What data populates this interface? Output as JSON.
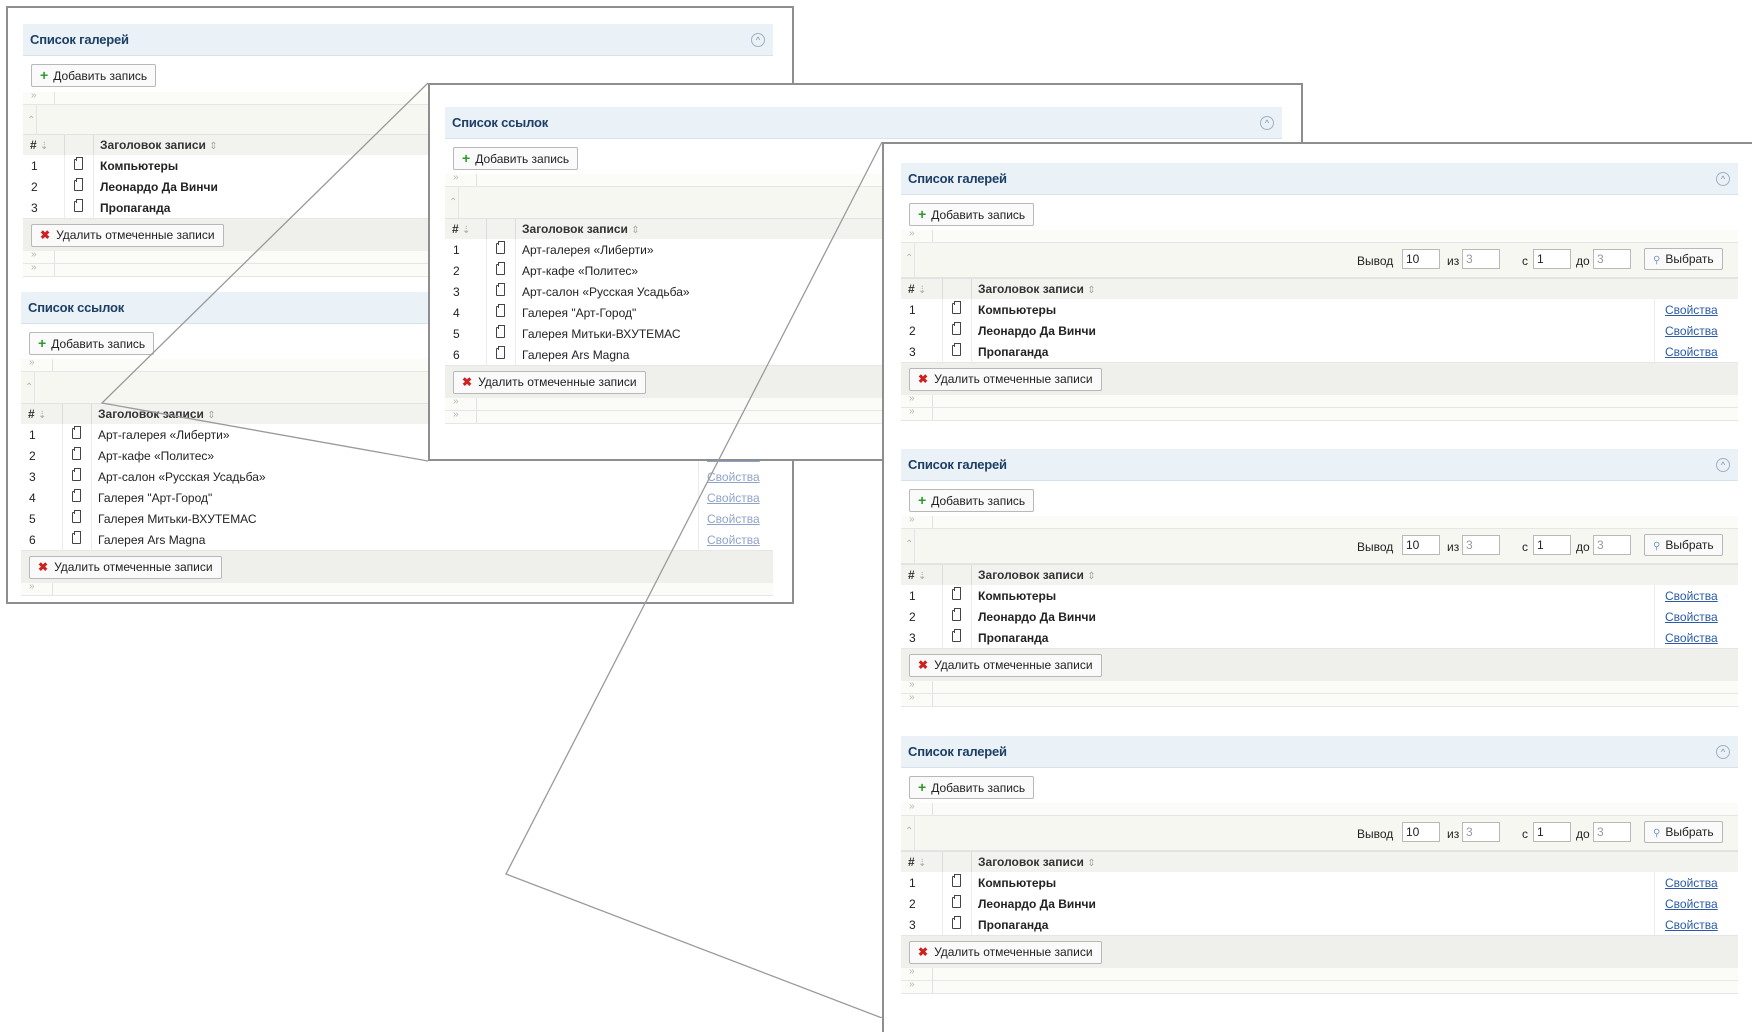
{
  "common": {
    "add_label": "Добавить запись",
    "delete_label": "Удалить отмеченные записи",
    "col_num": "#",
    "col_title": "Заголовок записи",
    "sort_num": "⇣",
    "sort_title": "⇕",
    "props_label": "Свойства",
    "expand_glyph": "»",
    "collapse_glyph": "«",
    "panel_toggle_glyph": "^"
  },
  "filter": {
    "out_label": "Вывод",
    "out_value": "10",
    "of_label": "из",
    "of_value": "3",
    "from_label": "с",
    "from_value": "1",
    "to_label": "до",
    "to_value": "3",
    "select_label": "Выбрать",
    "select_icon": "search-icon"
  },
  "gallery_panel": {
    "title": "Список галерей",
    "rows": [
      {
        "num": "1",
        "title": "Компьютеры"
      },
      {
        "num": "2",
        "title": "Леонардо Да Винчи"
      },
      {
        "num": "3",
        "title": "Пропаганда"
      }
    ]
  },
  "links_panel": {
    "title": "Список ссылок",
    "rows": [
      {
        "num": "1",
        "title": "Арт-галерея «Либерти»"
      },
      {
        "num": "2",
        "title": "Арт-кафе «Политес»"
      },
      {
        "num": "3",
        "title": "Арт-салон «Русская Усадьба»"
      },
      {
        "num": "4",
        "title": "Галерея \"Арт-Город\""
      },
      {
        "num": "5",
        "title": "Галерея Митьки-ВХУТЕМАС"
      },
      {
        "num": "6",
        "title": "Галерея Ars Magna"
      }
    ]
  },
  "colors": {
    "header_bg": "#eaf1f7",
    "title_color": "#1d3f66",
    "link_color": "#2a5aa8",
    "add_icon": "#2b9a2b",
    "delete_icon": "#cc2222"
  }
}
